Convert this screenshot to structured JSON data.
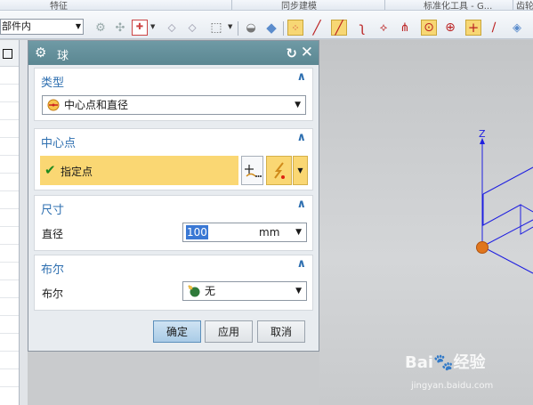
{
  "ribbon": {
    "groups": [
      "特征",
      "同步建模",
      "标准化工具 - G...",
      "齿轮"
    ]
  },
  "toolbar": {
    "scope_value": "部件内",
    "icons": [
      "select-feature-icon",
      "point-icon",
      "snap-icon",
      "box-select-icon",
      "solid-icon",
      "cube-icon",
      "grid-points-icon",
      "line-icon",
      "arc-icon",
      "spline-icon",
      "vertex-icon",
      "intersect-icon",
      "circle-center-icon",
      "circle-point-icon",
      "crosshair-icon",
      "pen-icon",
      "view-icon"
    ]
  },
  "dialog": {
    "title": "球",
    "type_section": {
      "label": "类型",
      "value": "中心点和直径"
    },
    "center_section": {
      "label": "中心点",
      "specify_label": "指定点"
    },
    "size_section": {
      "label": "尺寸",
      "diameter_label": "直径",
      "diameter_value": "100",
      "unit": "mm"
    },
    "boolean_section": {
      "label": "布尔",
      "boolean_label": "布尔",
      "value": "无"
    },
    "buttons": {
      "ok": "确定",
      "apply": "应用",
      "cancel": "取消"
    }
  },
  "viewport": {
    "axis_label": "Z",
    "colors": {
      "axis": "#1f1fe0",
      "origin": "#e0761e",
      "active": "#fad773",
      "accent": "#2e6fb0"
    }
  },
  "watermark": {
    "brand_a": "Bai",
    "brand_b": "经验",
    "url": "jingyan.baidu.com"
  }
}
